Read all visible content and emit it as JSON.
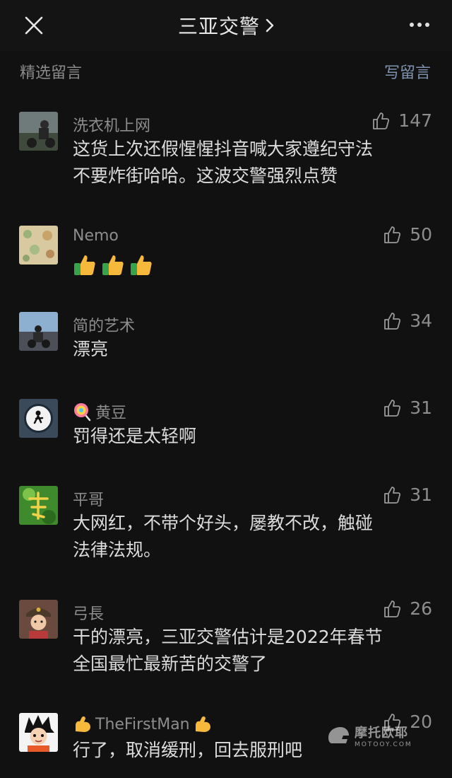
{
  "topbar": {
    "title": "三亚交警",
    "chevron": "›"
  },
  "section": {
    "title": "精选留言",
    "write_label": "写留言"
  },
  "icons": {
    "close": "close-icon",
    "more": "more-dots-icon",
    "like": "thumbs-up-icon"
  },
  "comments": [
    {
      "name": "洗衣机上网",
      "text_lines": [
        "这货上次还假惺惺抖音喊大家遵纪守法",
        "不要炸街哈哈。这波交警强烈点赞"
      ],
      "likes": "147"
    },
    {
      "name": "Nemo",
      "emoji": "👍👍👍",
      "likes": "50"
    },
    {
      "name": "简的艺术",
      "text_lines": [
        "漂亮"
      ],
      "likes": "34"
    },
    {
      "name": "黄豆",
      "name_prefix_emoji": "🍭",
      "text_lines": [
        "罚得还是太轻啊"
      ],
      "likes": "31"
    },
    {
      "name": "平哥",
      "text_lines": [
        "大网红，不带个好头，屡教不改，触碰",
        "法律法规。"
      ],
      "likes": "31"
    },
    {
      "name": "弓長",
      "text_lines": [
        "干的漂亮，三亚交警估计是2022年春节",
        "全国最忙最新苦的交警了"
      ],
      "likes": "26"
    },
    {
      "name": "TheFirstMan",
      "name_prefix_emoji": "💪",
      "name_suffix_emoji": "💪",
      "text_lines": [
        "行了，取消缓刑，回去服刑吧"
      ],
      "likes": "20"
    }
  ],
  "watermark": {
    "main": "摩托欧耶",
    "sub": "MOTOOY.COM"
  }
}
